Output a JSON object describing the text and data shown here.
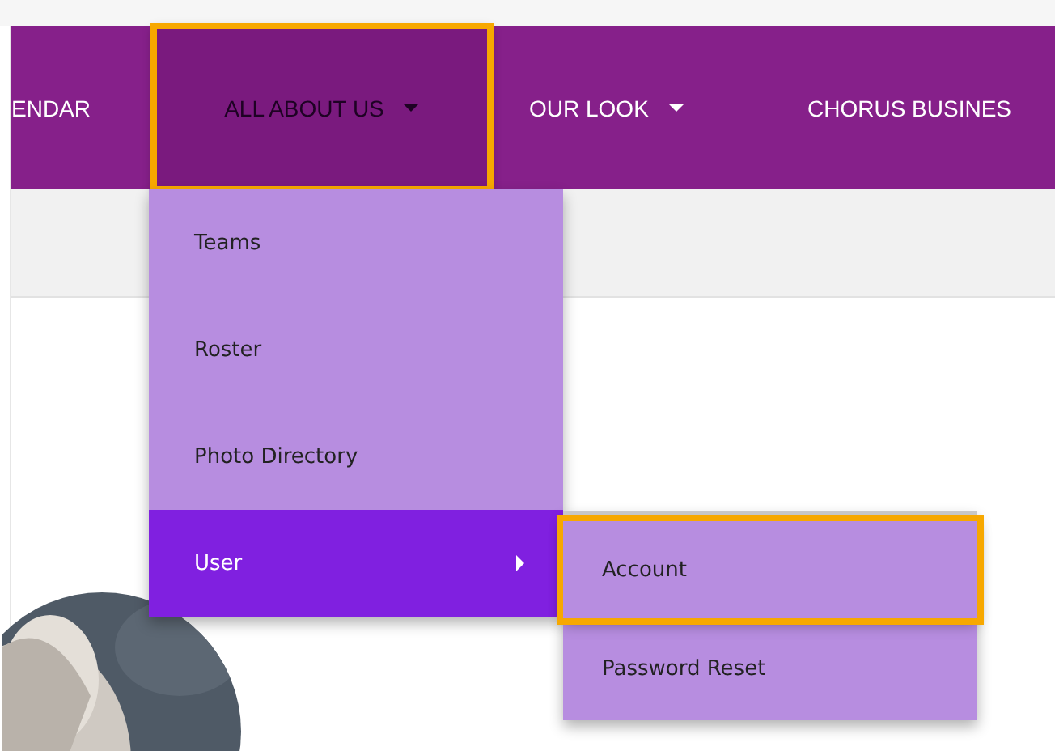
{
  "nav": {
    "items": [
      {
        "label": "ENDAR",
        "selected": false,
        "highlighted": false,
        "has_menu": false
      },
      {
        "label": "ALL ABOUT US",
        "selected": true,
        "highlighted": true,
        "has_menu": true
      },
      {
        "label": "OUR LOOK",
        "selected": false,
        "highlighted": false,
        "has_menu": true
      },
      {
        "label": "CHORUS BUSINES",
        "selected": false,
        "highlighted": false,
        "has_menu": false
      }
    ]
  },
  "dropdown": {
    "items": [
      {
        "label": "Teams",
        "selected": false,
        "has_submenu": false
      },
      {
        "label": "Roster",
        "selected": false,
        "has_submenu": false
      },
      {
        "label": "Photo Directory",
        "selected": false,
        "has_submenu": false
      },
      {
        "label": "User",
        "selected": true,
        "has_submenu": true
      }
    ]
  },
  "submenu": {
    "items": [
      {
        "label": "Account",
        "highlighted": true
      },
      {
        "label": "Password Reset",
        "highlighted": false
      }
    ]
  }
}
